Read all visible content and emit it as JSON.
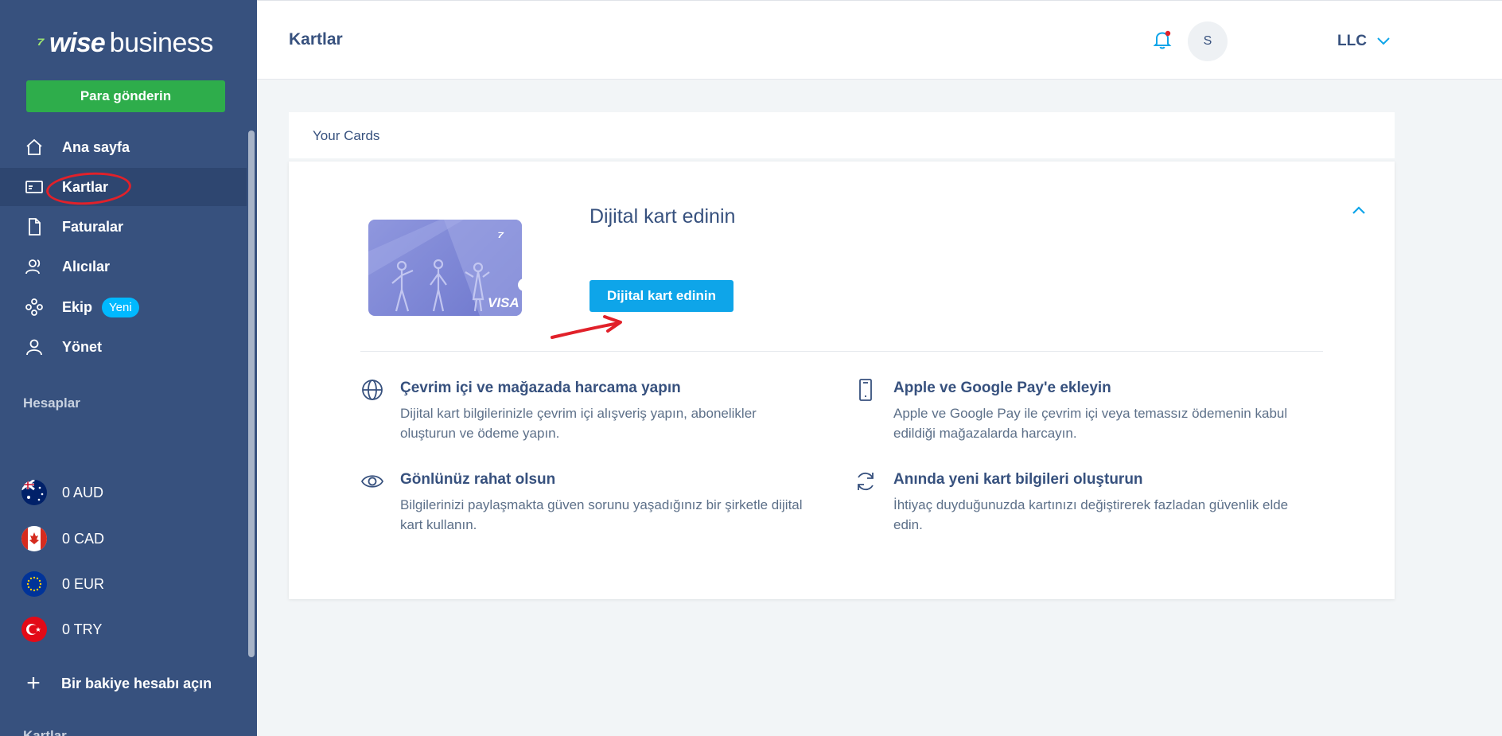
{
  "sidebar": {
    "logo_brand": "wise",
    "logo_suffix": "business",
    "send_button": "Para gönderin",
    "nav": [
      {
        "label": "Ana sayfa",
        "icon": "home-icon"
      },
      {
        "label": "Kartlar",
        "icon": "card-icon",
        "active": true
      },
      {
        "label": "Faturalar",
        "icon": "document-icon"
      },
      {
        "label": "Alıcılar",
        "icon": "recipients-icon"
      },
      {
        "label": "Ekip",
        "icon": "team-icon",
        "badge": "Yeni"
      },
      {
        "label": "Yönet",
        "icon": "user-icon"
      }
    ],
    "section_accounts": "Hesaplar",
    "accounts": [
      {
        "label": "0 AUD",
        "icon": "australia-flag-icon"
      },
      {
        "label": "0 CAD",
        "icon": "canada-flag-icon"
      },
      {
        "label": "0 EUR",
        "icon": "eu-flag-icon"
      },
      {
        "label": "0 TRY",
        "icon": "turkey-flag-icon"
      }
    ],
    "open_account": "Bir bakiye hesabı açın",
    "cutoff_label": "Kartlar"
  },
  "header": {
    "title": "Kartlar",
    "avatar_initials": "S",
    "account_name": "LLC"
  },
  "tabs": {
    "your_cards": "Your Cards"
  },
  "card_panel": {
    "title": "Dijital kart edinin",
    "cta": "Dijital kart edinin",
    "card_brand": "VISA",
    "features": [
      {
        "icon": "globe-icon",
        "title": "Çevrim içi ve mağazada harcama yapın",
        "desc": "Dijital kart bilgilerinizle çevrim içi alışveriş yapın, abonelikler oluşturun ve ödeme yapın."
      },
      {
        "icon": "phone-icon",
        "title": "Apple ve Google Pay'e ekleyin",
        "desc": "Apple ve Google Pay ile çevrim içi veya temassız ödemenin kabul edildiği mağazalarda harcayın."
      },
      {
        "icon": "eye-icon",
        "title": "Gönlünüz rahat olsun",
        "desc": "Bilgilerinizi paylaşmakta güven sorunu yaşadığınız bir şirketle dijital kart kullanın."
      },
      {
        "icon": "refresh-icon",
        "title": "Anında yeni kart bilgileri oluşturun",
        "desc": "İhtiyaç duyduğunuzda kartınızı değiştirerek fazladan güvenlik elde edin."
      }
    ]
  },
  "colors": {
    "sidebar_bg": "#37517e",
    "send_green": "#2ead4b",
    "cta_blue": "#0ea5e9",
    "annotation_red": "#e1212a"
  }
}
